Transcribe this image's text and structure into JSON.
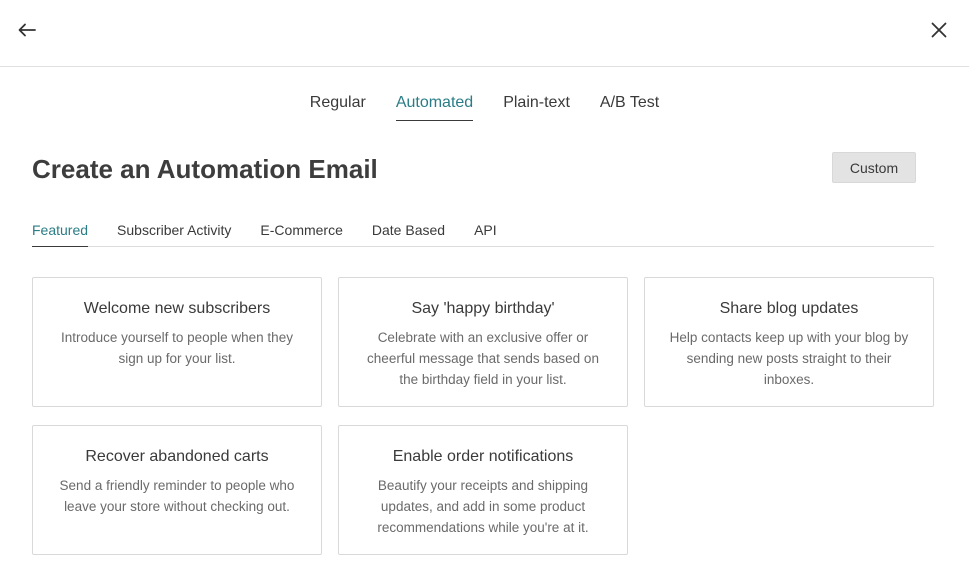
{
  "header": {
    "back_icon": "arrow-left-icon",
    "close_icon": "close-icon"
  },
  "type_tabs": [
    {
      "label": "Regular",
      "active": false
    },
    {
      "label": "Automated",
      "active": true
    },
    {
      "label": "Plain-text",
      "active": false
    },
    {
      "label": "A/B Test",
      "active": false
    }
  ],
  "page_title": "Create an Automation Email",
  "custom_button": "Custom",
  "category_tabs": [
    {
      "label": "Featured",
      "active": true
    },
    {
      "label": "Subscriber Activity",
      "active": false
    },
    {
      "label": "E-Commerce",
      "active": false
    },
    {
      "label": "Date Based",
      "active": false
    },
    {
      "label": "API",
      "active": false
    }
  ],
  "cards": [
    {
      "title": "Welcome new subscribers",
      "description": "Introduce yourself to people when they sign up for your list."
    },
    {
      "title": "Say 'happy birthday'",
      "description": "Celebrate with an exclusive offer or cheerful message that sends based on the birthday field in your list."
    },
    {
      "title": "Share blog updates",
      "description": "Help contacts keep up with your blog by sending new posts straight to their inboxes."
    },
    {
      "title": "Recover abandoned carts",
      "description": "Send a friendly reminder to people who leave your store without checking out."
    },
    {
      "title": "Enable order notifications",
      "description": "Beautify your receipts and shipping updates, and add in some product recommendations while you're at it."
    }
  ],
  "colors": {
    "accent": "#2a7d86",
    "text": "#3a3a3a",
    "muted": "#6a6a6a",
    "border": "#d9d9d9",
    "button_bg": "#e3e3e3"
  }
}
